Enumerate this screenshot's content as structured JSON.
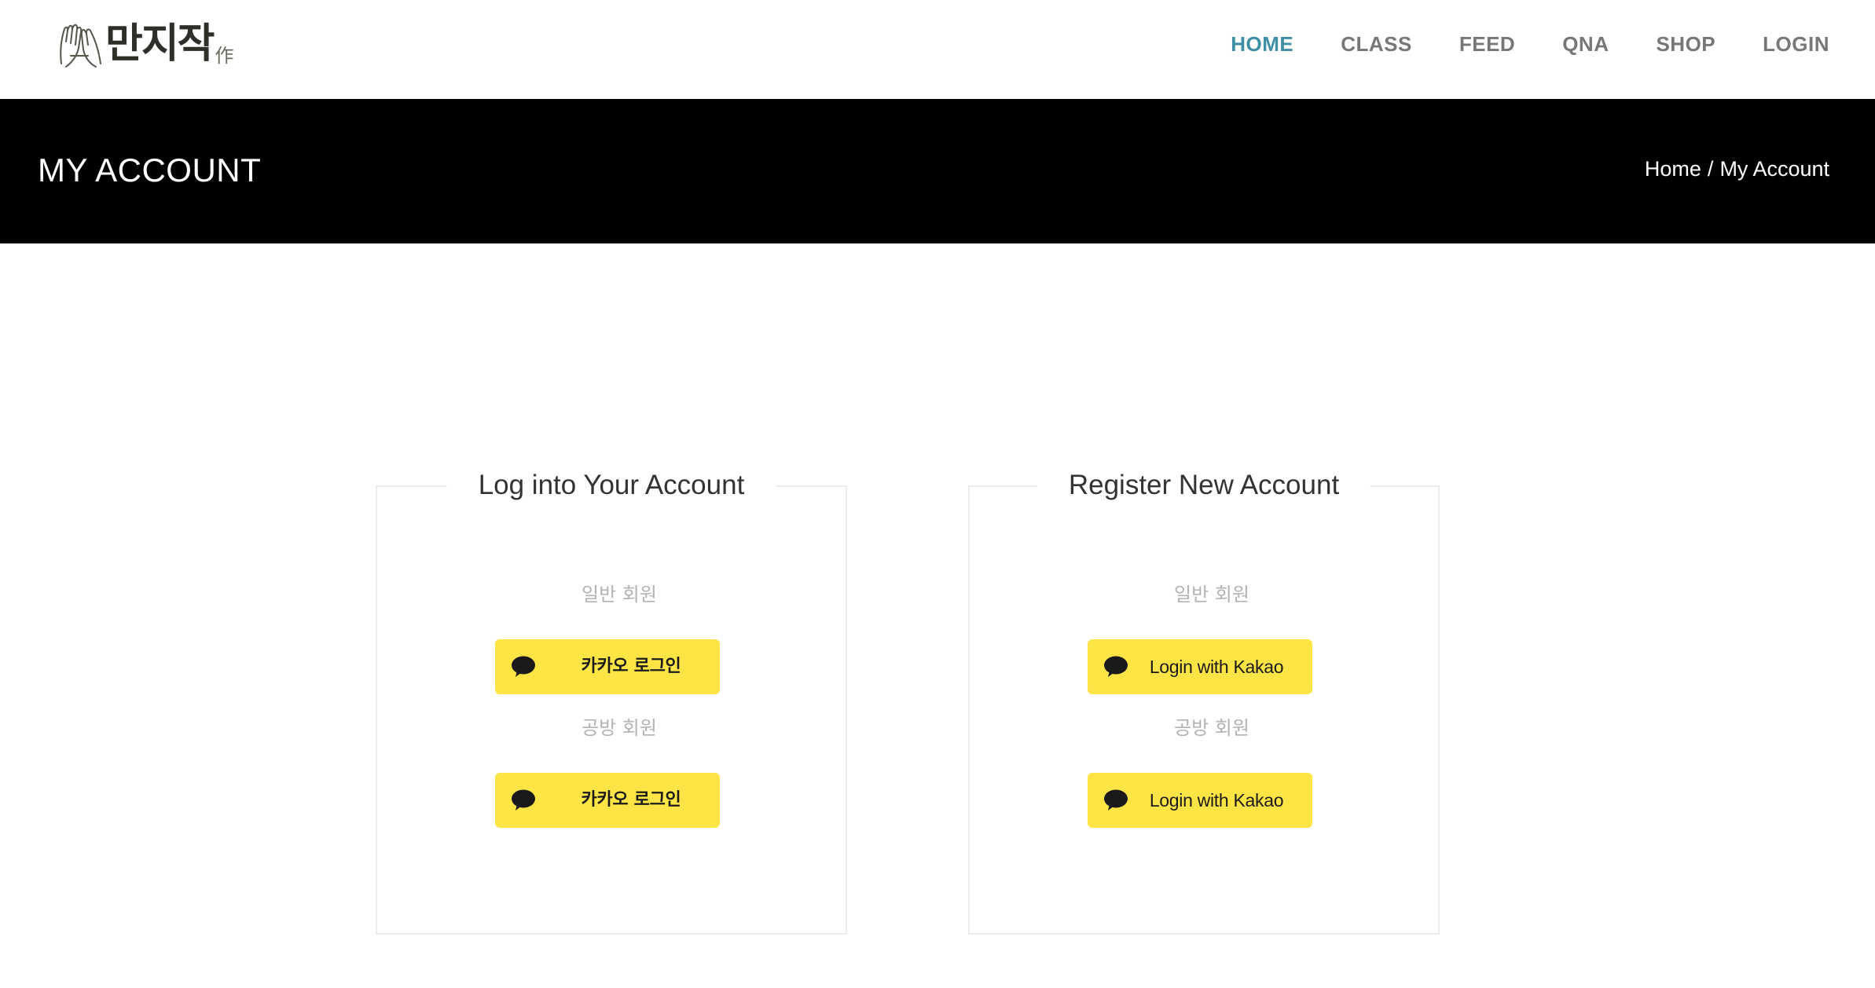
{
  "logo": {
    "text": "만지작",
    "sub": "作",
    "icon": "hands-logo-icon"
  },
  "nav": {
    "items": [
      {
        "label": "HOME",
        "active": true
      },
      {
        "label": "CLASS",
        "active": false
      },
      {
        "label": "FEED",
        "active": false
      },
      {
        "label": "QNA",
        "active": false
      },
      {
        "label": "SHOP",
        "active": false
      },
      {
        "label": "LOGIN",
        "active": false
      }
    ],
    "active_color": "#3d8fa6"
  },
  "banner": {
    "title": "MY ACCOUNT",
    "breadcrumb": {
      "home": "Home",
      "separator": "/",
      "current": "My Account"
    }
  },
  "login_panel": {
    "title": "Log into Your Account",
    "general_label": "일반 회원",
    "general_button": "카카오 로그인",
    "workshop_label": "공방 회원",
    "workshop_button": "카카오 로그인"
  },
  "register_panel": {
    "title": "Register New Account",
    "general_label": "일반 회원",
    "general_button": "Login with Kakao",
    "workshop_label": "공방 회원",
    "workshop_button": "Login with Kakao"
  },
  "kakao": {
    "button_color": "#fee545",
    "icon": "speech-bubble-icon"
  }
}
